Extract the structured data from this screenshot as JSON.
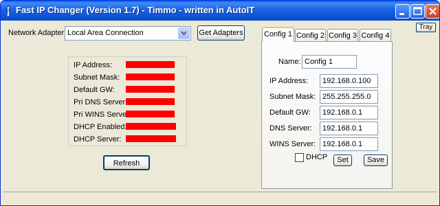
{
  "window": {
    "title": "Fast IP Changer (Version 1.7) - Timmo - written in AutoIT",
    "tray_label": "Tray"
  },
  "adapter": {
    "label": "Network Adapter:",
    "selected": "Local Area Connection",
    "get_button": "Get Adapters"
  },
  "info": {
    "rows": [
      {
        "label": "IP Address:"
      },
      {
        "label": "Subnet Mask:"
      },
      {
        "label": "Default GW:"
      },
      {
        "label": "Pri DNS Server:"
      },
      {
        "label": "Pri WINS Server:"
      },
      {
        "label": "DHCP Enabled:"
      },
      {
        "label": "DHCP Server:"
      }
    ],
    "value_color": "#ff0000",
    "refresh_button": "Refresh"
  },
  "tabs": [
    {
      "label": "Config 1",
      "active": true
    },
    {
      "label": "Config 2",
      "active": false
    },
    {
      "label": "Config 3",
      "active": false
    },
    {
      "label": "Config 4",
      "active": false
    }
  ],
  "config": {
    "name_label": "Name:",
    "name_value": "Config 1",
    "ip_label": "IP Address:",
    "ip_value": "192.168.0.100",
    "subnet_label": "Subnet Mask:",
    "subnet_value": "255.255.255.0",
    "gw_label": "Default GW:",
    "gw_value": "192.168.0.1",
    "dns_label": "DNS Server:",
    "dns_value": "192.168.0.1",
    "wins_label": "WINS Server:",
    "wins_value": "192.168.0.1",
    "dhcp_label": "DHCP",
    "dhcp_checked": false,
    "set_button": "Set",
    "save_button": "Save"
  },
  "colors": {
    "titlebar": "#0b54d6",
    "window_bg": "#ece9d8",
    "tab_highlight": "#ffc83c"
  }
}
